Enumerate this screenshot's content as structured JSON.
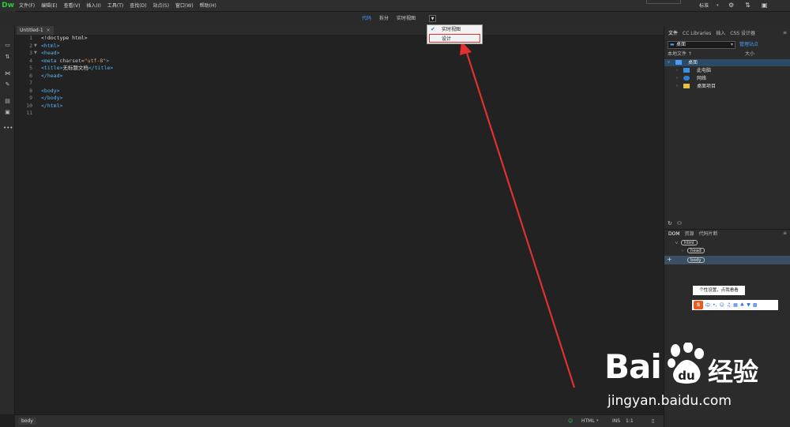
{
  "app": {
    "logo": "Dw",
    "workspace": "标准"
  },
  "menu": [
    "文件(F)",
    "编辑(E)",
    "查看(V)",
    "插入(I)",
    "工具(T)",
    "查找(D)",
    "站点(S)",
    "窗口(W)",
    "帮助(H)"
  ],
  "view_tabs": {
    "code": "代码",
    "split": "拆分",
    "live": "实时视图"
  },
  "view_dropdown": {
    "items": [
      "实时视图",
      "设计"
    ],
    "checked": "实时视图",
    "highlighted": "设计"
  },
  "document_tab": {
    "title": "Untitled-1",
    "close": "×"
  },
  "editor": {
    "line_numbers": [
      "1",
      "2",
      "3",
      "4",
      "5",
      "6",
      "7",
      "8",
      "9",
      "10",
      "11"
    ],
    "lines": [
      {
        "a": "<!doctype html>"
      },
      {
        "a": "<html>"
      },
      {
        "a": "<head>"
      },
      {
        "a": "<meta ",
        "b": "charset=",
        "c": "\"utf-8\"",
        "d": ">"
      },
      {
        "a": "<title>",
        "b": "无标题文档",
        "c": "</title>"
      },
      {
        "a": "</head>"
      },
      {
        "a": ""
      },
      {
        "a": "<body>"
      },
      {
        "a": "</body>"
      },
      {
        "a": "</html>"
      },
      {
        "a": ""
      }
    ]
  },
  "status_bar": {
    "tag": "body",
    "language": "HTML",
    "mode": "INS",
    "position": "1:1"
  },
  "files_panel": {
    "tabs": [
      "文件",
      "CC Libraries",
      "插入",
      "CSS 设计器"
    ],
    "site": "桌面",
    "manage_sites": "管理站点",
    "col_local": "本地文件 ↑",
    "col_size": "大小",
    "items": [
      {
        "label": "桌面",
        "icon": "desktop-icon"
      },
      {
        "label": "此电脑",
        "icon": "computer-icon"
      },
      {
        "label": "网络",
        "icon": "network-icon"
      },
      {
        "label": "桌面项目",
        "icon": "folder-icon"
      }
    ]
  },
  "dom_panel": {
    "tabs": [
      "DOM",
      "资源",
      "代码片断"
    ],
    "nodes": [
      "html",
      "head",
      "body"
    ]
  },
  "ime": {
    "tooltip": "个性设置，点我看看",
    "mode": "中"
  },
  "watermark": {
    "brand": "Bai",
    "brand_zh": "经验",
    "url": "jingyan.baidu.com"
  },
  "colors": {
    "accent": "#4a9cf5",
    "arrow": "#e03030",
    "dw_green": "#2ecc40"
  }
}
